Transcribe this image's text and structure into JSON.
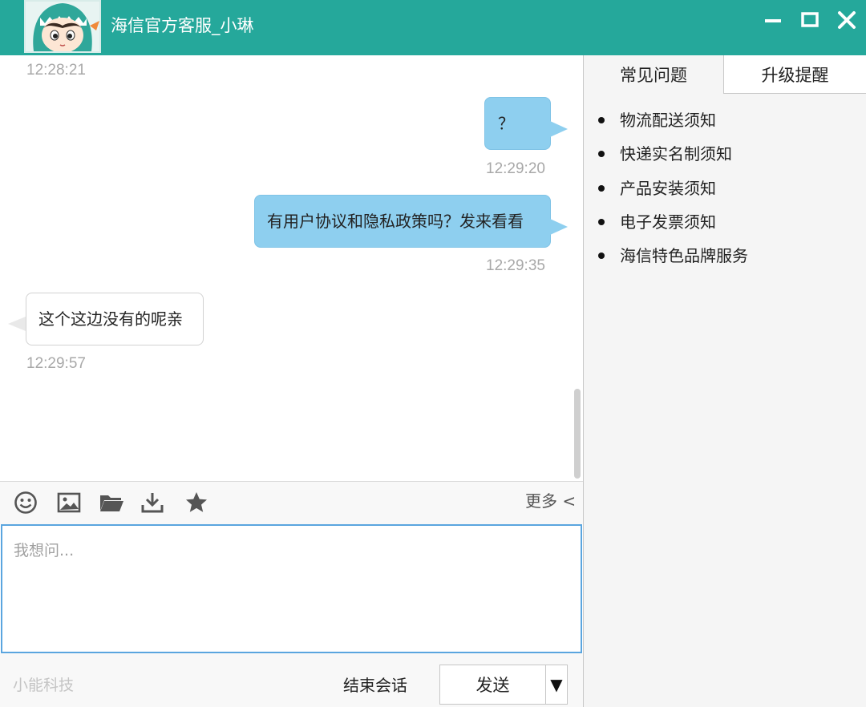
{
  "window": {
    "title": "海信官方客服_小琳",
    "accent_color": "#25a89b",
    "controls": [
      "minimize-icon",
      "maximize-icon",
      "close-icon"
    ]
  },
  "chat": {
    "messages": [
      {
        "time": "12:28:21"
      },
      {
        "direction": "outgoing",
        "text": "？",
        "time": "12:29:20"
      },
      {
        "direction": "outgoing",
        "text": "有用户协议和隐私政策吗？发来看看",
        "time": "12:29:35"
      },
      {
        "direction": "incoming",
        "text": "这个这边没有的呢亲",
        "time": "12:29:57"
      }
    ],
    "outgoing_bubble_color": "#8ecfef"
  },
  "toolbar": {
    "icons": [
      "emoji-icon",
      "image-icon",
      "folder-icon",
      "download-icon",
      "star-icon"
    ],
    "more_label": "更多 <"
  },
  "input": {
    "placeholder": "我想问...",
    "value": ""
  },
  "footer": {
    "brand": "小能科技",
    "end_label": "结束会话",
    "send_label": "发送",
    "dropdown_glyph": "▼"
  },
  "sidebar": {
    "tabs": [
      {
        "label": "常见问题",
        "active": true
      },
      {
        "label": "升级提醒",
        "active": false
      }
    ],
    "faq_items": [
      {
        "label": "物流配送须知"
      },
      {
        "label": "快递实名制须知"
      },
      {
        "label": "产品安装须知"
      },
      {
        "label": "电子发票须知"
      },
      {
        "label": "海信特色品牌服务"
      }
    ]
  }
}
